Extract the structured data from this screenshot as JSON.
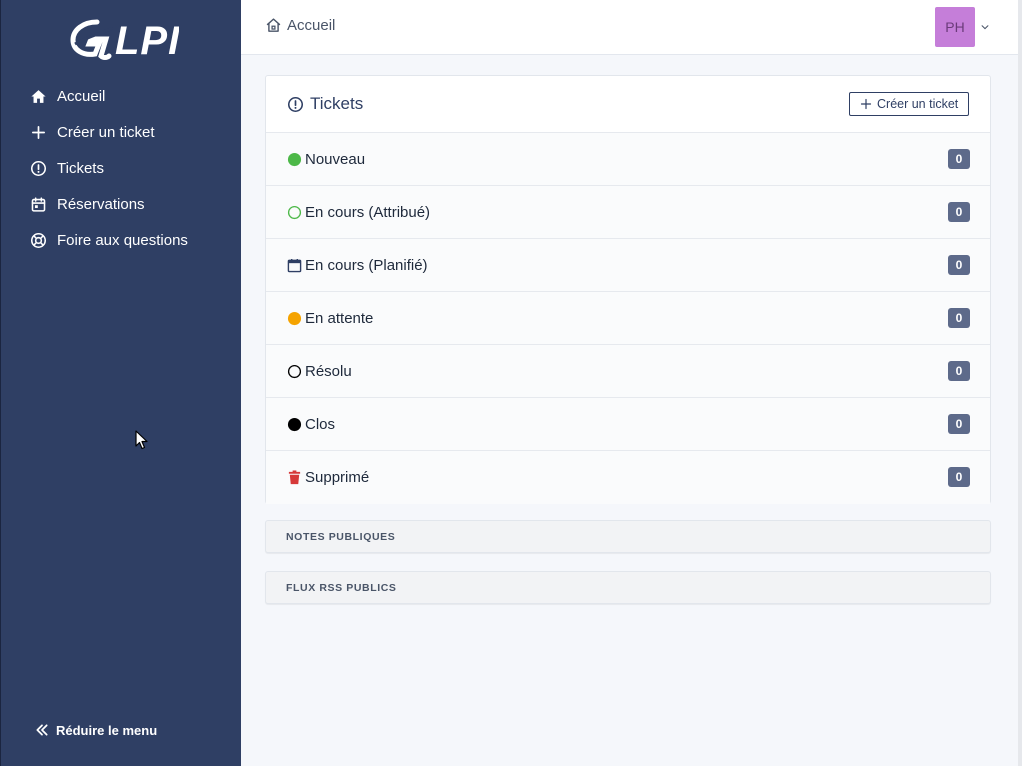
{
  "app": {
    "logo_text": "GLPI"
  },
  "sidebar": {
    "items": [
      {
        "label": "Accueil",
        "icon": "home-icon"
      },
      {
        "label": "Créer un ticket",
        "icon": "plus-icon"
      },
      {
        "label": "Tickets",
        "icon": "alert-circle-icon"
      },
      {
        "label": "Réservations",
        "icon": "calendar-icon"
      },
      {
        "label": "Foire aux questions",
        "icon": "lifebuoy-icon"
      }
    ],
    "collapse_label": "Réduire le menu"
  },
  "header": {
    "breadcrumb": "Accueil",
    "user_initials": "PH"
  },
  "tickets_card": {
    "title": "Tickets",
    "create_button": "Créer un ticket",
    "rows": [
      {
        "label": "Nouveau",
        "count": "0",
        "icon": "green-filled-circle-icon"
      },
      {
        "label": "En cours (Attribué)",
        "count": "0",
        "icon": "green-outline-circle-icon"
      },
      {
        "label": "En cours (Planifié)",
        "count": "0",
        "icon": "calendar-icon"
      },
      {
        "label": "En attente",
        "count": "0",
        "icon": "orange-filled-circle-icon"
      },
      {
        "label": "Résolu",
        "count": "0",
        "icon": "black-outline-circle-icon"
      },
      {
        "label": "Clos",
        "count": "0",
        "icon": "black-filled-circle-icon"
      },
      {
        "label": "Supprimé",
        "count": "0",
        "icon": "trash-icon"
      }
    ]
  },
  "panels": {
    "public_notes": "NOTES PUBLIQUES",
    "public_rss": "FLUX RSS PUBLICS"
  },
  "colors": {
    "sidebar_bg": "#2f3f64",
    "badge_bg": "#5d6a8a",
    "avatar_bg": "#c57ed9",
    "status_new": "#4cb848",
    "status_waiting": "#f5a300",
    "status_deleted": "#d63939"
  }
}
